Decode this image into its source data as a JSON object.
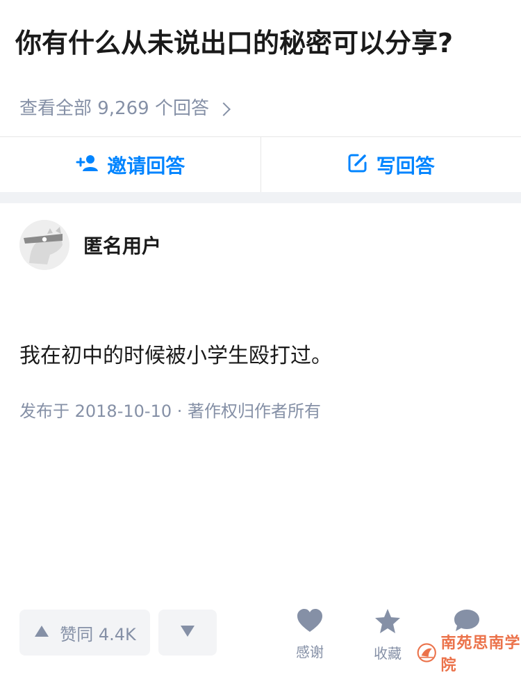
{
  "question": {
    "title": "你有什么从未说出口的秘密可以分享?",
    "view_all_label": "查看全部 9,269 个回答"
  },
  "actions": {
    "invite_label": "邀请回答",
    "write_label": "写回答"
  },
  "answer": {
    "author_name": "匿名用户",
    "text": "我在初中的时候被小学生殴打过。",
    "meta": "发布于 2018-10-10 · 著作权归作者所有"
  },
  "toolbar": {
    "upvote_label": "赞同 4.4K",
    "thanks_label": "感谢",
    "favorite_label": "收藏"
  },
  "watermark": {
    "text": "南苑思南学院"
  },
  "colors": {
    "accent": "#0084ff",
    "muted": "#8590a6",
    "band": "#f0f2f5",
    "watermark": "#e85a2b"
  },
  "icons": {
    "invite": "add-user-icon",
    "write": "edit-icon",
    "upvote": "triangle-up-icon",
    "downvote": "triangle-down-icon",
    "thanks": "heart-icon",
    "favorite": "star-icon",
    "comment": "comment-bubble-icon"
  }
}
